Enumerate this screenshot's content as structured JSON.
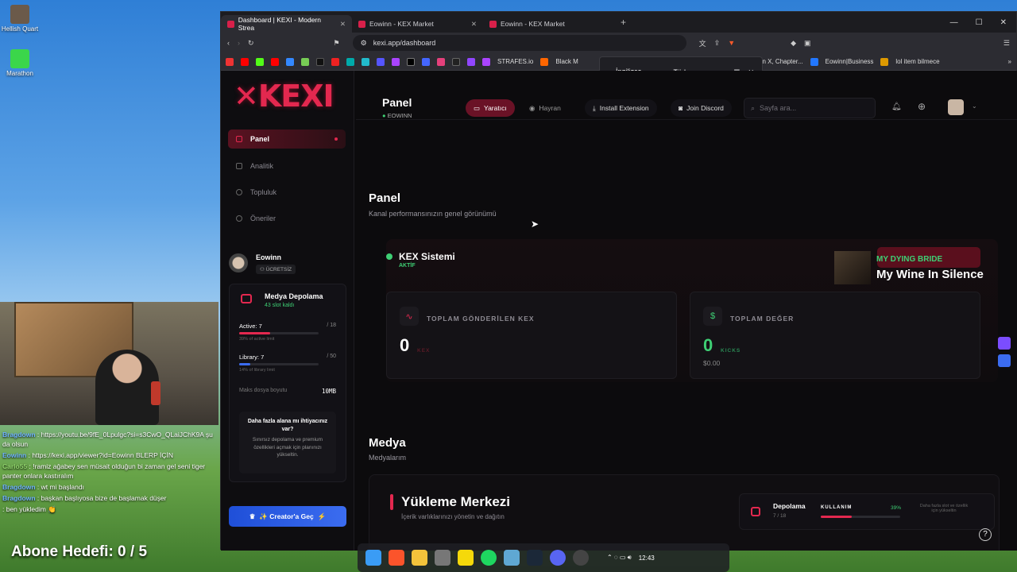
{
  "desktop": {
    "icons": [
      {
        "label": "Hellish Quart"
      },
      {
        "label": "Marathon"
      }
    ]
  },
  "chat": {
    "lines": [
      {
        "user": "Bragdown",
        "text": " : https://youtu.be/9fE_0Lpulgc?si=s3CwO_QLaiJChK9A şu da olsun"
      },
      {
        "user": "Eowinn",
        "text": " : https://kexi.app/viewer?id=Eowinn BLERP İÇİN"
      },
      {
        "user": "Carlo55",
        "text": " : !ramiz ağabey sen müsait olduğun bi zaman gel seni tiger panter onlara kastıralım"
      },
      {
        "user": "Bragdown",
        "text": " : wt mi başlandı"
      },
      {
        "user": "Bragdown",
        "text": " : başkan başlıyosa bize de başlamak düşer"
      },
      {
        "user": "",
        "text": " : ben yükledim 👏"
      }
    ],
    "goal": "Abone Hedefi:  0 / 5"
  },
  "browser": {
    "tabs": [
      {
        "title": "Dashboard | KEXI - Modern Strea",
        "active": true
      },
      {
        "title": "Eowinn - KEX Market",
        "active": false
      },
      {
        "title": "Eowinn - KEX Market",
        "active": false
      }
    ],
    "url": "kexi.app/dashboard",
    "bookmarks": [
      "STRAFES.io",
      "Black M",
      "Choujin X, Chapter...",
      "Eowinn|Business",
      "lol item bilmece"
    ],
    "translate": {
      "from": "İngilizce",
      "to": "Türkçe"
    }
  },
  "sidebar": {
    "logo": "KEXI",
    "nav": [
      {
        "label": "Panel",
        "active": true
      },
      {
        "label": "Analitik",
        "active": false
      },
      {
        "label": "Topluluk",
        "active": false
      },
      {
        "label": "Öneriler",
        "active": false
      }
    ],
    "user": {
      "name": "Eowinn",
      "plan": "ÜCRETSİZ"
    },
    "storage": {
      "title": "Medya Depolama",
      "slots": "43 slot kaldı",
      "active_label": "Active: 7",
      "active_max": "/ 18",
      "active_note": "39% of active limit",
      "active_pct": 0.39,
      "library_label": "Library: 7",
      "library_max": "/ 50",
      "library_note": "14% of library limit",
      "library_pct": 0.14,
      "max_size_label": "Maks dosya boyutu",
      "max_size": "10MB",
      "upsell_title": "Daha fazla alana mı ihtiyacınız var?",
      "upsell_text": "Sınırsız depolama ve premium özellikleri açmak için planınızı yükseltin."
    },
    "cta": "✨ Creator'a Geç"
  },
  "topbar": {
    "title": "Panel",
    "user": "EOWINN",
    "creator": "Yaratıcı",
    "fan": "Hayran",
    "install": "Install Extension",
    "discord": "Join Discord",
    "search_placeholder": "Sayfa ara..."
  },
  "main": {
    "title": "Panel",
    "subtitle": "Kanal performansınızın genel görünümü",
    "kex": {
      "title": "KEX Sistemi",
      "status": "AKTİF"
    },
    "stats": [
      {
        "label": "TOPLAM GÖNDERİLEN KEX",
        "value": "0",
        "unit": "KEX",
        "extra": ""
      },
      {
        "label": "TOPLAM DEĞER",
        "value": "0",
        "unit": "KICKS",
        "extra": "$0.00"
      }
    ],
    "song": {
      "artist": "MY DYING BRIDE",
      "title": "My Wine In Silence"
    },
    "media": {
      "title": "Medya",
      "subtitle": "Medyalarım"
    },
    "upload": {
      "title": "Yükleme Merkezi",
      "subtitle": "İçerik varlıklarınızı yönetin ve dağıtın"
    },
    "storage_mini": {
      "label": "Depolama",
      "count": "7 / 18",
      "usage": "KULLANIM",
      "pct": "39%",
      "pct_value": 0.39,
      "note": "Daha fazla slot ve özellik için yükseltin"
    }
  },
  "taskbar": {
    "time": "12:43"
  }
}
